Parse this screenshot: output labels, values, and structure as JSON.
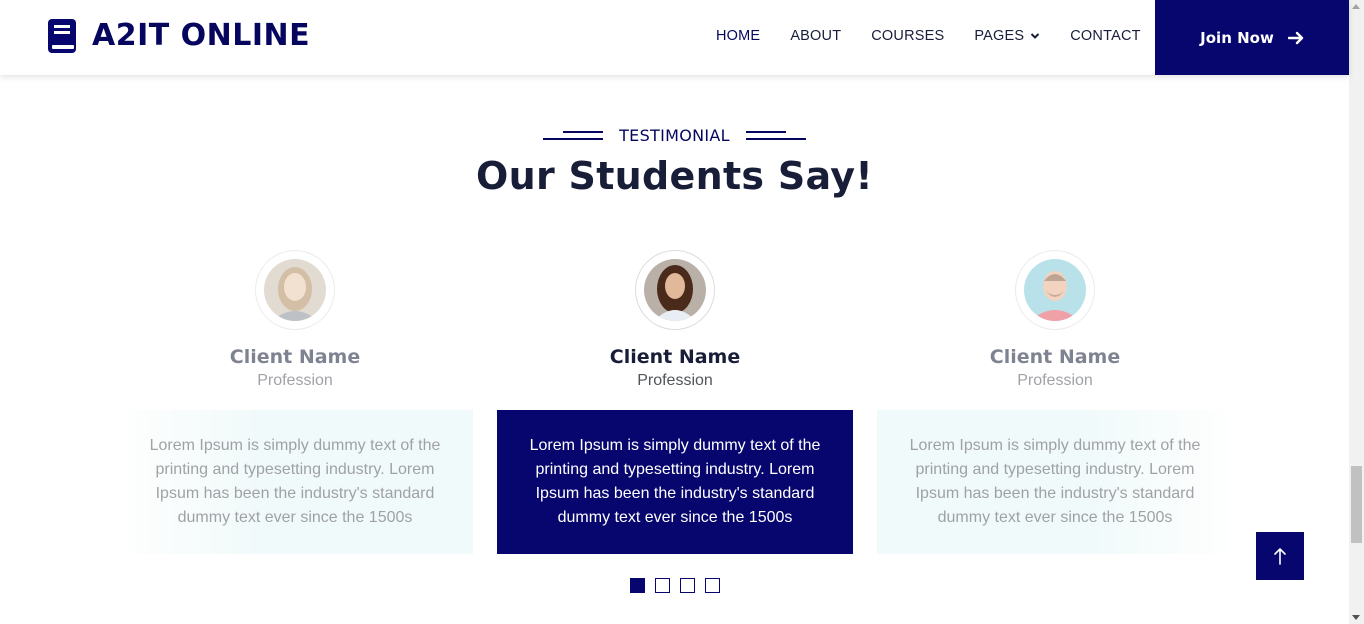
{
  "brand": {
    "name": "A2IT ONLINE",
    "icon": "book-icon"
  },
  "nav": {
    "items": [
      {
        "label": "HOME",
        "active": true
      },
      {
        "label": "ABOUT"
      },
      {
        "label": "COURSES"
      },
      {
        "label": "PAGES",
        "dropdown": true
      },
      {
        "label": "CONTACT"
      }
    ],
    "join_label": "Join Now"
  },
  "section": {
    "kicker": "TESTIMONIAL",
    "title": "Our Students Say!"
  },
  "testimonials": [
    {
      "name": "Client Name",
      "profession": "Profession",
      "quote": "Lorem Ipsum is simply dummy text of the printing and typesetting industry. Lorem Ipsum has been the industry's standard dummy text ever since the 1500s"
    },
    {
      "name": "Client Name",
      "profession": "Profession",
      "quote": "Lorem Ipsum is simply dummy text of the printing and typesetting industry. Lorem Ipsum has been the industry's standard dummy text ever since the 1500s"
    },
    {
      "name": "Client Name",
      "profession": "Profession",
      "quote": "Lorem Ipsum is simply dummy text of the printing and typesetting industry. Lorem Ipsum has been the industry's standard dummy text ever since the 1500s"
    }
  ],
  "carousel": {
    "dots": 4,
    "active_dot": 1
  },
  "colors": {
    "primary": "#06066e",
    "dark": "#181d38",
    "light_bg": "#e6f6f7"
  }
}
